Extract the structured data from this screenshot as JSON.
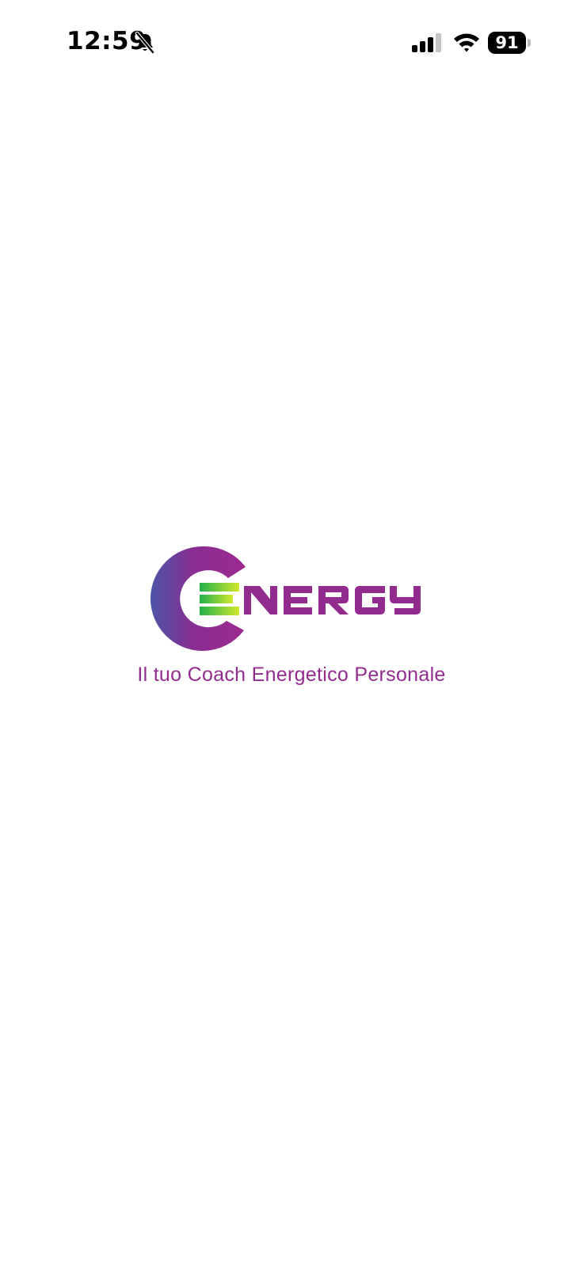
{
  "status_bar": {
    "time": "12:59",
    "battery_level": "91",
    "icons": [
      "bell-slash-icon",
      "cellular-signal-icon",
      "wifi-icon",
      "battery-icon"
    ]
  },
  "splash": {
    "logo_text": "ENERGY",
    "tagline": "Il tuo Coach Energetico Personale"
  },
  "colors": {
    "brand_purple": "#922b8e",
    "ring_blue": "#4b55a6",
    "bar_green": "#22b14c",
    "bar_lime": "#c8e62d",
    "background": "#ffffff"
  }
}
